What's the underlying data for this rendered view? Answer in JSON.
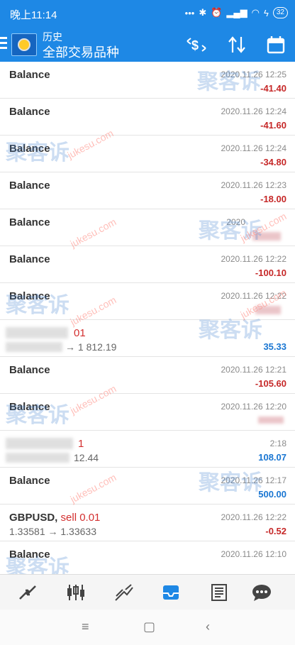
{
  "status": {
    "time": "晚上11:14",
    "battery": "32"
  },
  "toolbar": {
    "title": "历史",
    "subtitle": "全部交易品种"
  },
  "rows": [
    {
      "symbol": "Balance",
      "side": "",
      "prices": "",
      "time": "2020.11.26 12:25",
      "amount": "-41.40",
      "sign": "neg"
    },
    {
      "symbol": "Balance",
      "side": "",
      "prices": "",
      "time": "2020.11.26 12:24",
      "amount": "-41.60",
      "sign": "neg"
    },
    {
      "symbol": "Balance",
      "side": "",
      "prices": "",
      "time": "2020.11.26 12:24",
      "amount": "-34.80",
      "sign": "neg"
    },
    {
      "symbol": "Balance",
      "side": "",
      "prices": "",
      "time": "2020.11.26 12:23",
      "amount": "-18.00",
      "sign": "neg"
    },
    {
      "symbol": "Balance",
      "side": "",
      "prices": "",
      "time": "2020",
      "amount": "",
      "sign": "neg"
    },
    {
      "symbol": "Balance",
      "side": "",
      "prices": "",
      "time": "2020.11.26 12:22",
      "amount": "-100.10",
      "sign": "neg"
    },
    {
      "symbol": "Balance",
      "side": "",
      "prices": "",
      "time": "2020.11.26 12:22",
      "amount": "",
      "sign": "neg"
    },
    {
      "symbol": "",
      "side": "01",
      "prices": "→ 1 812.19",
      "time": "",
      "amount": "35.33",
      "sign": "pos"
    },
    {
      "symbol": "Balance",
      "side": "",
      "prices": "",
      "time": "2020.11.26 12:21",
      "amount": "-105.60",
      "sign": "neg"
    },
    {
      "symbol": "Balance",
      "side": "",
      "prices": "",
      "time": "2020.11.26 12:20",
      "amount": "",
      "sign": "neg"
    },
    {
      "symbol": "",
      "side": "1",
      "prices": "12.44",
      "time": "2:18",
      "amount": "108.07",
      "sign": "pos"
    },
    {
      "symbol": "Balance",
      "side": "",
      "prices": "",
      "time": "2020.11.26 12:17",
      "amount": "500.00",
      "sign": "pos"
    },
    {
      "symbol": "GBPUSD,",
      "side": "sell 0.01",
      "prices": "1.33581 → 1.33633",
      "time": "2020.11.26 12:22",
      "amount": "-0.52",
      "sign": "neg"
    },
    {
      "symbol": "Balance",
      "side": "",
      "prices": "",
      "time": "2020.11.26 12:10",
      "amount": "",
      "sign": "neg"
    }
  ],
  "watermark": {
    "cn": "聚客诉",
    "en": "jukesu.com"
  },
  "colors": {
    "primary": "#1e88e5",
    "negative": "#c62828",
    "positive": "#1976d2"
  },
  "icons": {
    "toolbar": [
      "dollar-swap-icon",
      "sort-icon",
      "calendar-icon"
    ],
    "nav": [
      "quotes-icon",
      "chart-icon",
      "trade-icon",
      "history-icon",
      "news-icon",
      "chat-icon"
    ],
    "system": [
      "menu-icon",
      "home-icon",
      "back-icon"
    ]
  }
}
